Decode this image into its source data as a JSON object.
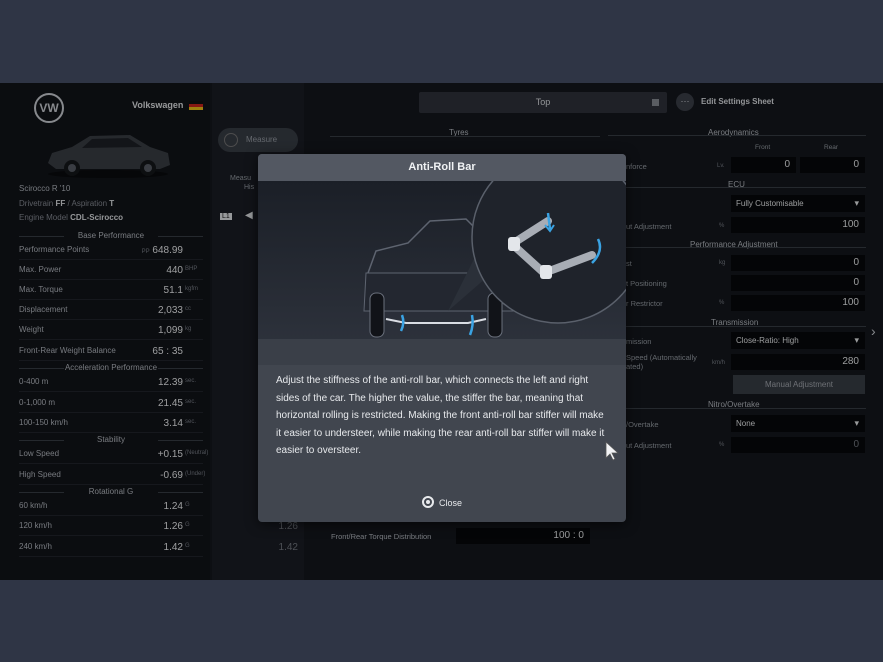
{
  "app": {
    "brand": "Volkswagen"
  },
  "car": {
    "model": "Scirocco R '10",
    "drivetrain_label": "Drivetrain",
    "drivetrain": "FF",
    "aspiration_label": "Aspiration",
    "aspiration": "T",
    "engine_label": "Engine Model",
    "engine": "CDL-Scirocco"
  },
  "base_performance": {
    "heading": "Base Performance",
    "rows": [
      {
        "label": "Performance Points",
        "prefix": "PP",
        "value": "648.99",
        "unit": ""
      },
      {
        "label": "Max. Power",
        "value": "440",
        "unit": "BHP"
      },
      {
        "label": "Max. Torque",
        "value": "51.1",
        "unit": "kgfm"
      },
      {
        "label": "Displacement",
        "value": "2,033",
        "unit": "cc"
      },
      {
        "label": "Weight",
        "value": "1,099",
        "unit": "kg"
      },
      {
        "label": "Front-Rear Weight Balance",
        "value": "65 : 35",
        "unit": ""
      }
    ]
  },
  "acceleration": {
    "heading": "Acceleration Performance",
    "rows": [
      {
        "label": "0-400 m",
        "value": "12.39",
        "unit": "sec."
      },
      {
        "label": "0-1,000 m",
        "value": "21.45",
        "unit": "sec."
      },
      {
        "label": "100-150 km/h",
        "value": "3.14",
        "unit": "sec."
      }
    ]
  },
  "stability": {
    "heading": "Stability",
    "rows": [
      {
        "label": "Low Speed",
        "value": "+0.15",
        "unit": "(Neutral)"
      },
      {
        "label": "High Speed",
        "value": "-0.69",
        "unit": "(Under)"
      }
    ]
  },
  "rotational": {
    "heading": "Rotational G",
    "rows": [
      {
        "label": "60 km/h",
        "value": "1.24",
        "unit": "G"
      },
      {
        "label": "120 km/h",
        "value": "1.26",
        "unit": "G"
      },
      {
        "label": "240 km/h",
        "value": "1.42",
        "unit": "G"
      }
    ]
  },
  "middle": {
    "measure_label": "Measure",
    "measured_label": "Measu",
    "history_label": "His",
    "lap_label": "L1",
    "values": [
      "1.26",
      "1.42"
    ]
  },
  "toolbar": {
    "view_select": "Top",
    "dots_label": "⋯",
    "edit_sheet_label": "Edit Settings Sheet"
  },
  "settings": {
    "tyres_heading": "Tyres",
    "aero_heading": "Aerodynamics",
    "aero_front_label": "Front",
    "aero_rear_label": "Rear",
    "downforce_label": "nforce",
    "downforce_unit": "Lv.",
    "downforce_front": "0",
    "downforce_rear": "0",
    "ecu_heading": "ECU",
    "ecu_select": "Fully Customisable",
    "output_adj_label": "ut Adjustment",
    "output_adj_unit": "%",
    "output_adj_value": "100",
    "perf_adj_heading": "Performance Adjustment",
    "ballast_label": "st",
    "ballast_unit": "kg",
    "ballast_value": "0",
    "ballast_pos_label": "t Positioning",
    "ballast_pos_value": "0",
    "restrictor_label": "r Restrictor",
    "restrictor_unit": "%",
    "restrictor_value": "100",
    "transmission_heading": "Transmission",
    "transmission_label": "mission",
    "transmission_select": "Close-Ratio: High",
    "topspeed_label": "Speed (Automatically ated)",
    "topspeed_unit": "km/h",
    "topspeed_value": "280",
    "manual_adj_label": "Manual Adjustment",
    "nitro_heading": "Nitro/Overtake",
    "nitro_label": "/Overtake",
    "nitro_select": "None",
    "nitro_adj_label": "ut Adjustment",
    "nitro_adj_unit": "%",
    "nitro_adj_value": "0",
    "torque_dist_label": "Front/Rear Torque Distribution",
    "torque_dist_value": "100 : 0"
  },
  "modal": {
    "title": "Anti-Roll Bar",
    "body": "Adjust the stiffness of the anti-roll bar, which connects the left and right sides of the car. The higher the value, the stiffer the bar, meaning that horizontal rolling is restricted. Making the front anti-roll bar stiffer will make it easier to understeer, while making the rear anti-roll bar stiffer will make it easier to oversteer.",
    "close_label": "Close"
  },
  "colors": {
    "background": "#2b3140",
    "panel": "#121419",
    "modal": "#41464f",
    "accent": "#3aa3e3"
  }
}
